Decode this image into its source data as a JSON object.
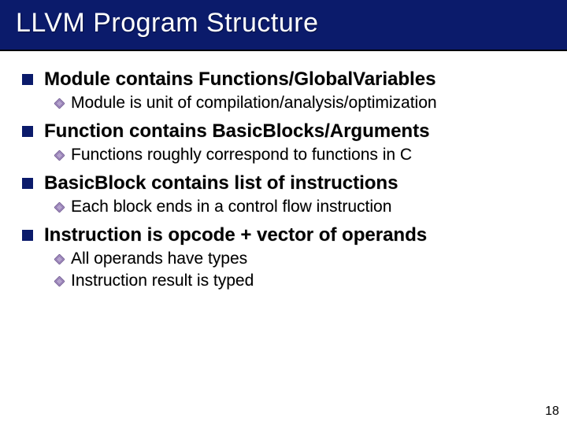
{
  "title": "LLVM Program Structure",
  "items": [
    {
      "heading": "Module contains Functions/GlobalVariables",
      "subs": [
        "Module is unit of compilation/analysis/optimization"
      ]
    },
    {
      "heading": "Function contains BasicBlocks/Arguments",
      "subs": [
        "Functions roughly correspond to functions in C"
      ]
    },
    {
      "heading": "BasicBlock contains list of instructions",
      "subs": [
        "Each block ends in a control flow instruction"
      ]
    },
    {
      "heading": "Instruction is opcode + vector of operands",
      "subs": [
        "All operands have types",
        "Instruction result is typed"
      ]
    }
  ],
  "slide_number": "18"
}
